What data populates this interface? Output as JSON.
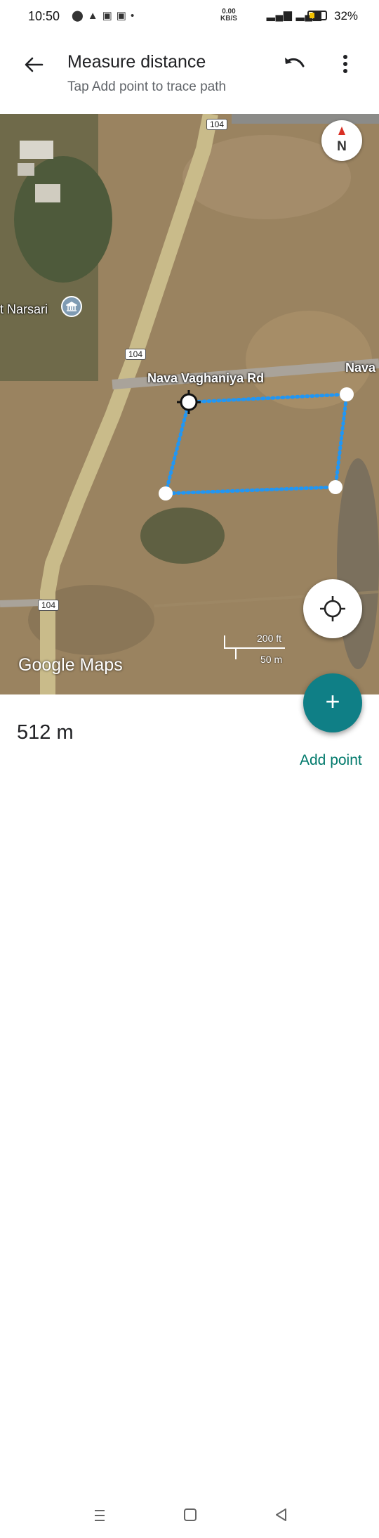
{
  "status_bar": {
    "time": "10:50",
    "net_speed_value": "0.00",
    "net_speed_unit": "KB/S",
    "battery_percent": "32%",
    "battery_level": 0.32,
    "network": "4G"
  },
  "app_bar": {
    "title": "Measure distance",
    "subtitle": "Tap Add point to trace path",
    "back_icon": "arrow-left-icon",
    "undo_icon": "undo-icon",
    "more_icon": "more-vert-icon"
  },
  "map": {
    "road_shields": [
      "104",
      "104",
      "104"
    ],
    "road_name": "Nava Vaghaniya Rd",
    "road_name_partial": "Nava",
    "place_name": "t Narsari",
    "compass_label": "N",
    "attribution": "Google Maps",
    "scale_imperial": "200 ft",
    "scale_metric": "50 m",
    "path_color": "#2196f3"
  },
  "bottom": {
    "distance": "512 m",
    "add_point_label": "Add point",
    "fab_icon": "plus-icon",
    "accent": "#0f7f86"
  }
}
